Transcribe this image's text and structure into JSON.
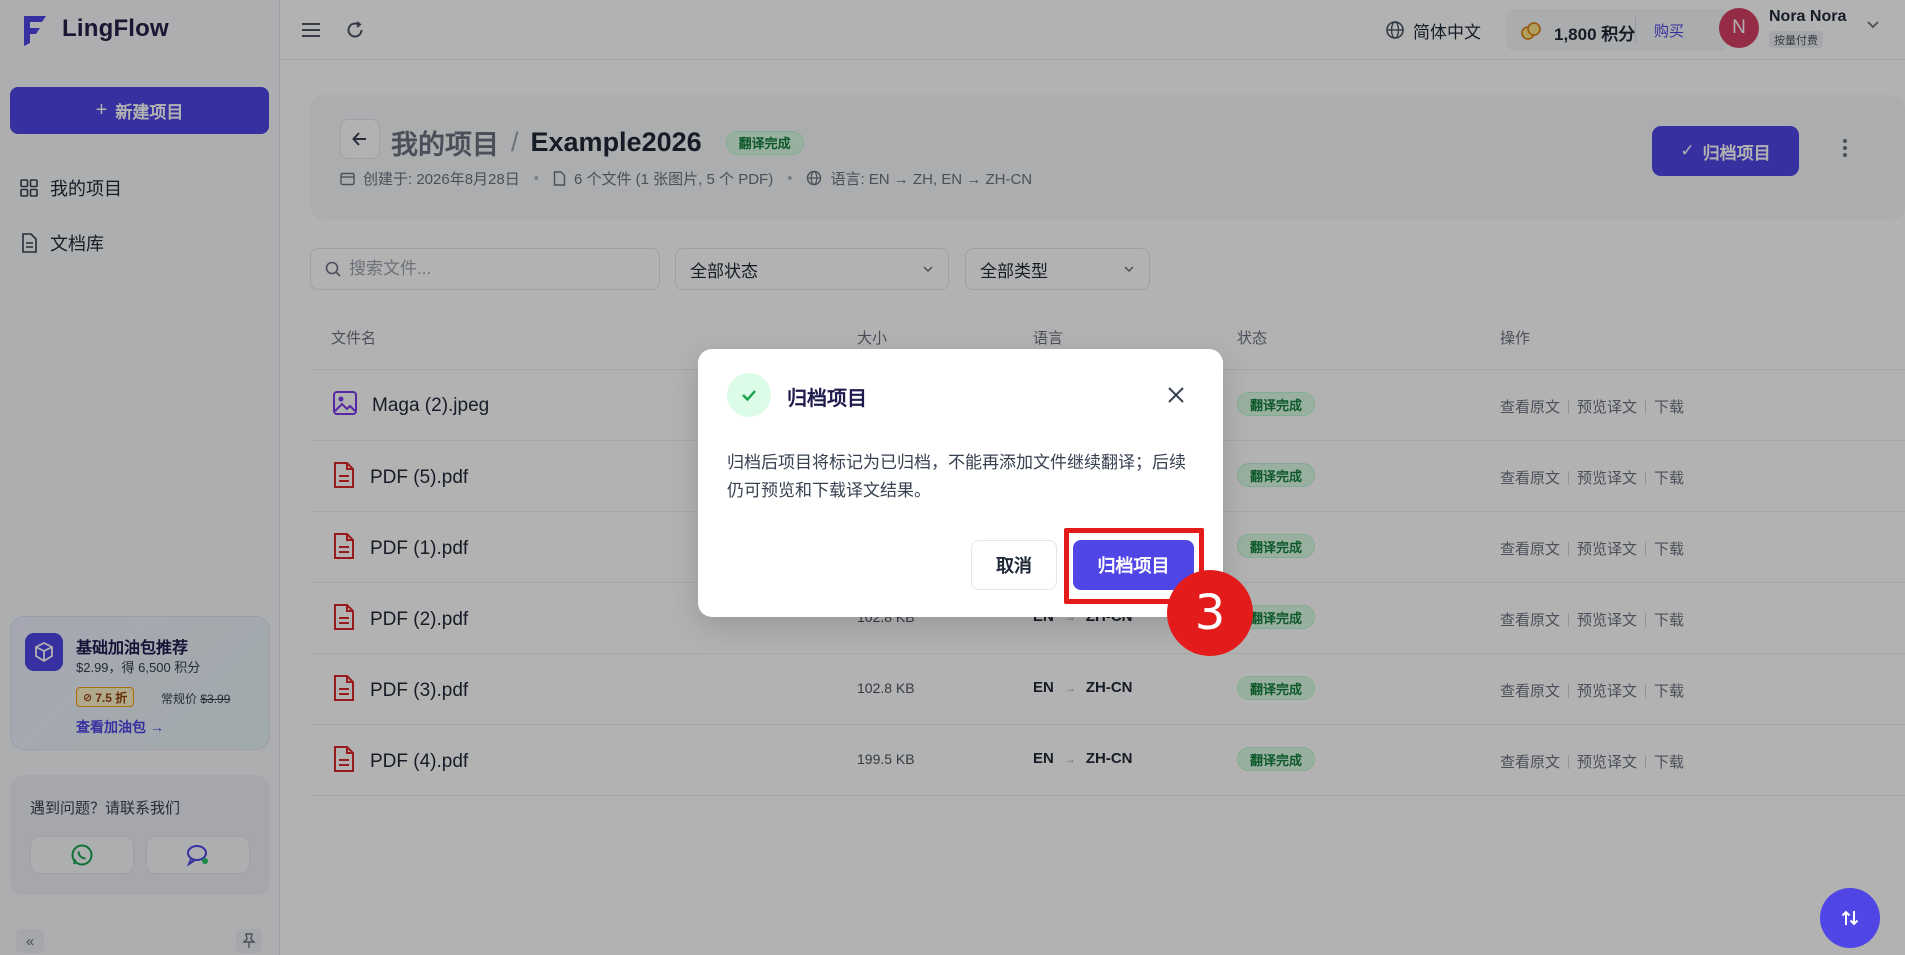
{
  "app": {
    "name": "LingFlow",
    "new_project_label": "新建项目"
  },
  "sidebar": {
    "items": [
      {
        "label": "我的项目",
        "icon": "grid-icon"
      },
      {
        "label": "文档库",
        "icon": "document-icon"
      }
    ],
    "promo": {
      "title": "基础加油包推荐",
      "subtitle": "$2.99，得 6,500 积分",
      "discount": "7.5 折",
      "regular_label": "常规价",
      "regular_price": "$3.99",
      "link": "查看加油包"
    },
    "help": {
      "title": "遇到问题？请联系我们"
    }
  },
  "topbar": {
    "language": "简体中文",
    "credits": "1,800 积分",
    "buy_label": "购买",
    "user": {
      "initial": "N",
      "name": "Nora Nora",
      "plan": "按量付费"
    }
  },
  "project": {
    "breadcrumb_root": "我的项目",
    "breadcrumb_sep": "/",
    "name": "Example2026",
    "status": "翻译完成",
    "created": "创建于: 2026年8月28日",
    "files": "6 个文件 (1 张图片, 5 个 PDF)",
    "languages": "语言: EN → ZH, EN → ZH-CN",
    "archive_label": "归档项目"
  },
  "filters": {
    "search_placeholder": "搜索文件...",
    "status_select": "全部状态",
    "type_select": "全部类型"
  },
  "table": {
    "headers": {
      "name": "文件名",
      "size": "大小",
      "language": "语言",
      "status": "状态",
      "actions": "操作"
    },
    "action_labels": {
      "view_source": "查看原文",
      "preview": "预览译文",
      "download": "下载"
    },
    "rows": [
      {
        "name": "Maga (2).jpeg",
        "type": "image",
        "size": "",
        "src": "",
        "tgt": "",
        "status": "翻译完成"
      },
      {
        "name": "PDF (5).pdf",
        "type": "pdf",
        "size": "",
        "src": "",
        "tgt": "",
        "status": "翻译完成"
      },
      {
        "name": "PDF (1).pdf",
        "type": "pdf",
        "size": "",
        "src": "",
        "tgt": "",
        "status": "翻译完成"
      },
      {
        "name": "PDF (2).pdf",
        "type": "pdf",
        "size": "102.8 KB",
        "src": "EN",
        "tgt": "ZH-CN",
        "status": "翻译完成"
      },
      {
        "name": "PDF (3).pdf",
        "type": "pdf",
        "size": "102.8 KB",
        "src": "EN",
        "tgt": "ZH-CN",
        "status": "翻译完成"
      },
      {
        "name": "PDF (4).pdf",
        "type": "pdf",
        "size": "199.5 KB",
        "src": "EN",
        "tgt": "ZH-CN",
        "status": "翻译完成"
      }
    ]
  },
  "modal": {
    "title": "归档项目",
    "body": "归档后项目将标记为已归档，不能再添加文件继续翻译；后续仍可预览和下载译文结果。",
    "cancel_label": "取消",
    "confirm_label": "归档项目"
  },
  "annotation": {
    "step": "3"
  },
  "colors": {
    "accent": "#4f46e5",
    "success_bg": "#dcfce7",
    "success_text": "#15803d",
    "highlight": "#e31b1b"
  }
}
